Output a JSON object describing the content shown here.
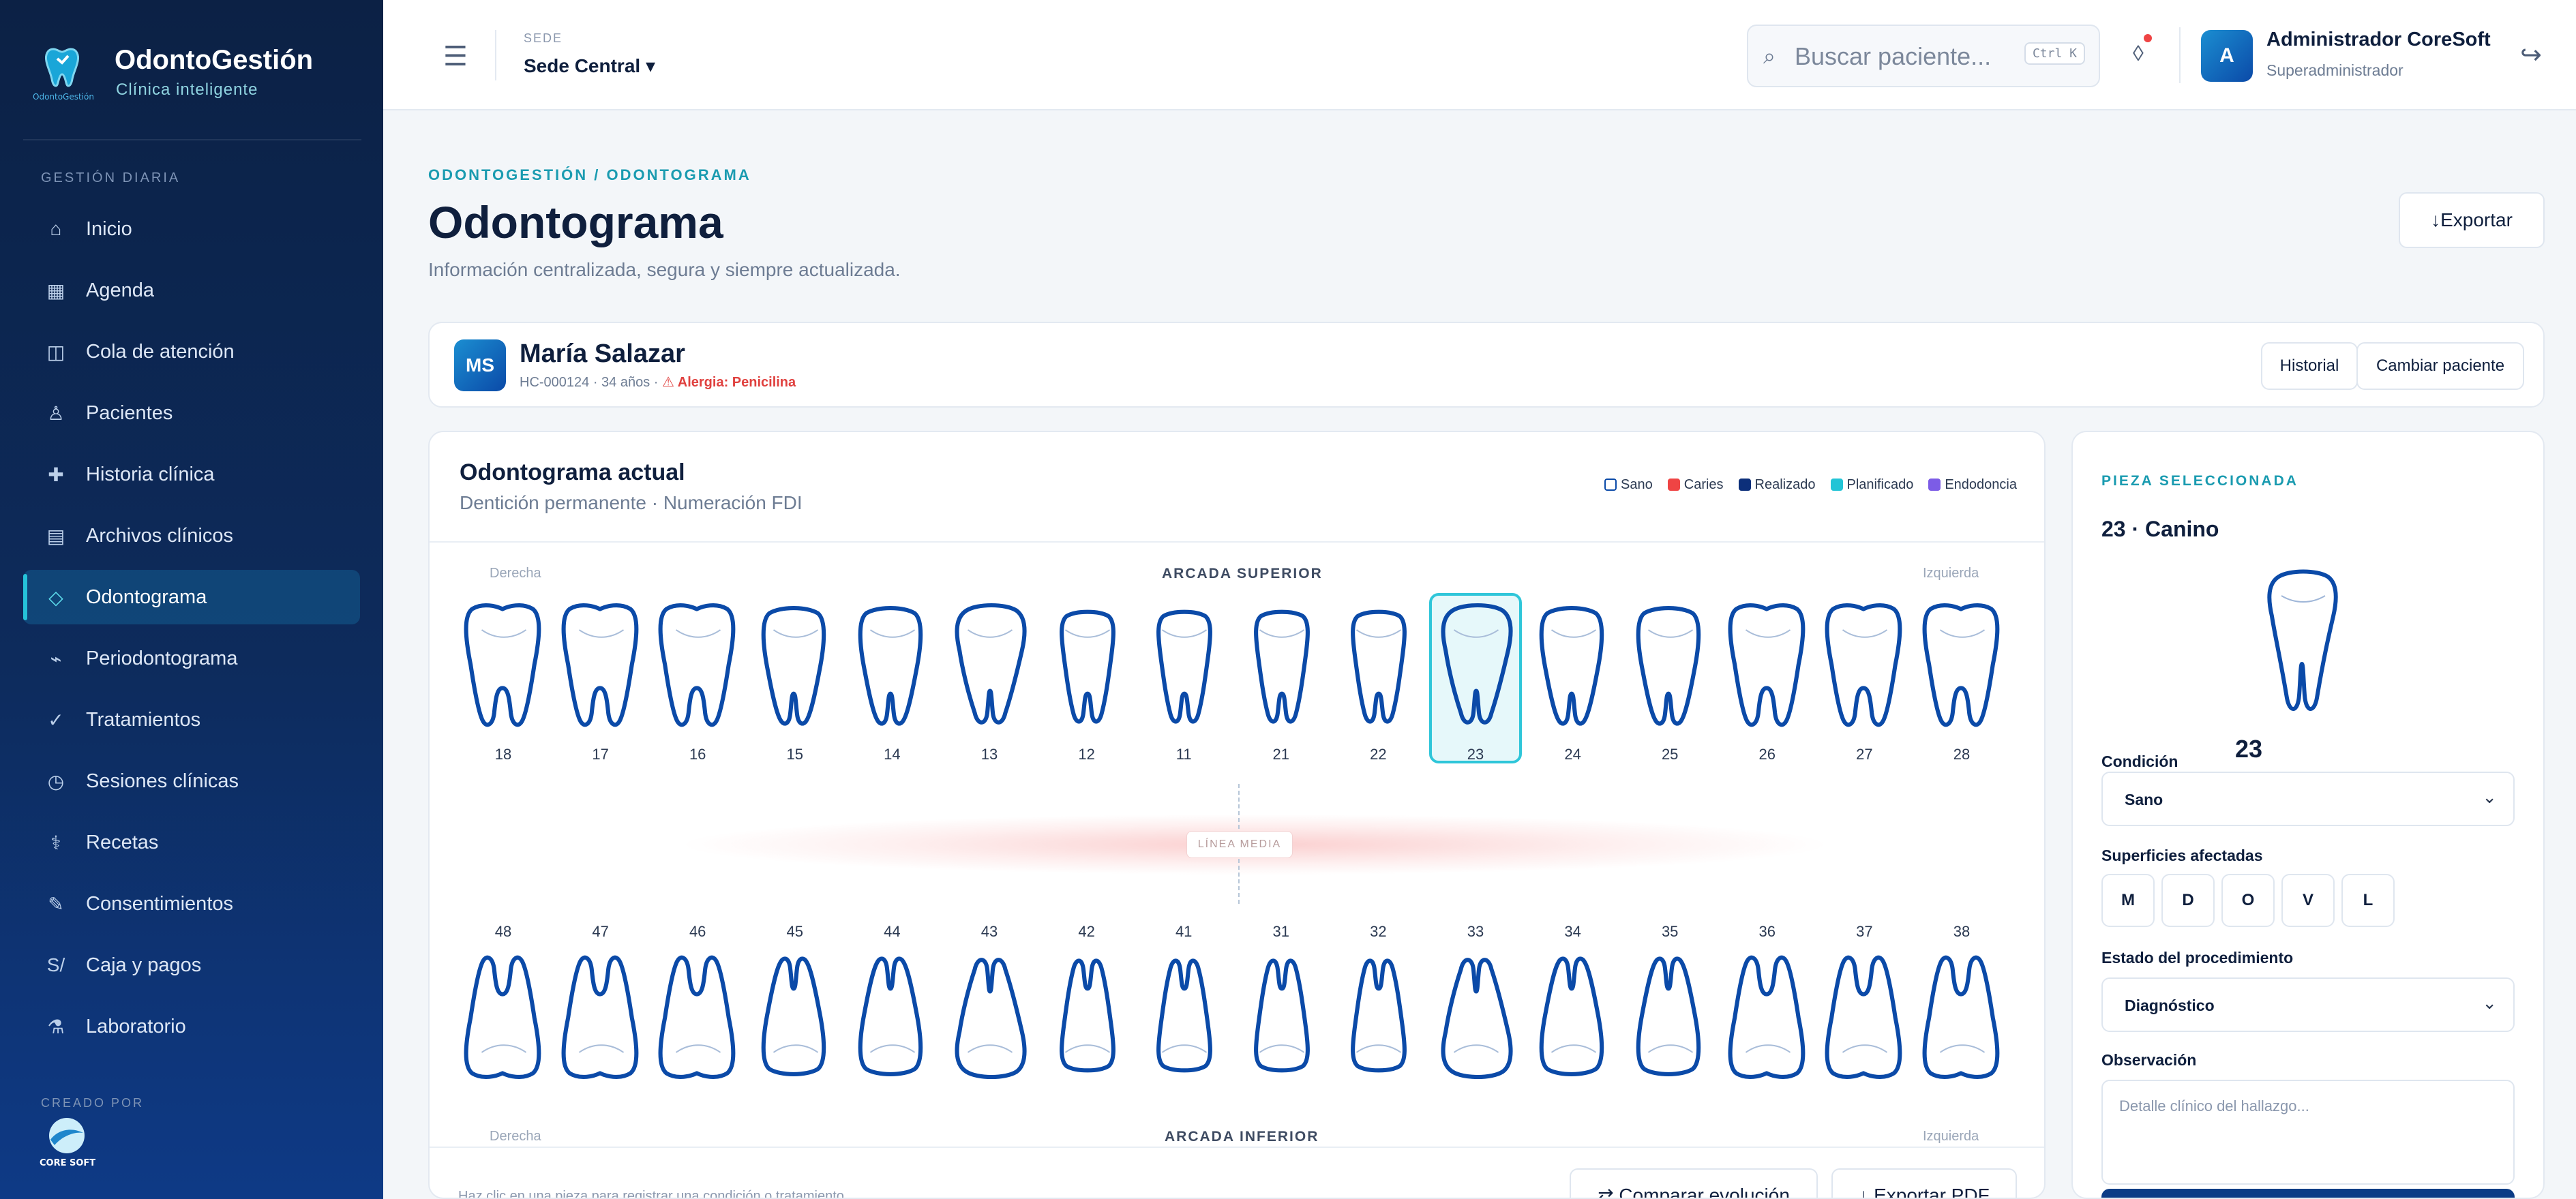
{
  "brand": {
    "title": "OdontoGestión",
    "subtitle": "Clínica inteligente",
    "logo_text": "OdontoGestión"
  },
  "sidebar": {
    "section_label": "GESTIÓN DIARIA",
    "items": [
      {
        "label": "Inicio",
        "icon": "home-icon",
        "glyph": "⌂"
      },
      {
        "label": "Agenda",
        "icon": "calendar-icon",
        "glyph": "▦"
      },
      {
        "label": "Cola de atención",
        "icon": "queue-icon",
        "glyph": "◫"
      },
      {
        "label": "Pacientes",
        "icon": "user-icon",
        "glyph": "♙"
      },
      {
        "label": "Historia clínica",
        "icon": "plus-icon",
        "glyph": "✚"
      },
      {
        "label": "Archivos clínicos",
        "icon": "files-icon",
        "glyph": "▤"
      },
      {
        "label": "Odontograma",
        "icon": "diamond-icon",
        "glyph": "◇",
        "active": true
      },
      {
        "label": "Periodontograma",
        "icon": "pulse-icon",
        "glyph": "⌁"
      },
      {
        "label": "Tratamientos",
        "icon": "check-icon",
        "glyph": "✓"
      },
      {
        "label": "Sesiones clínicas",
        "icon": "clock-icon",
        "glyph": "◷"
      },
      {
        "label": "Recetas",
        "icon": "pill-icon",
        "glyph": "⚕"
      },
      {
        "label": "Consentimientos",
        "icon": "pen-icon",
        "glyph": "✎"
      },
      {
        "label": "Caja y pagos",
        "icon": "currency-icon",
        "glyph": "S/"
      },
      {
        "label": "Laboratorio",
        "icon": "flask-icon",
        "glyph": "⚗"
      }
    ],
    "created_by": "CREADO POR",
    "coresoft_label": "CORE SOFT"
  },
  "topbar": {
    "menu_glyph": "☰",
    "sede_label": "SEDE",
    "sede_value": "Sede Central ▾",
    "search_placeholder": "Buscar paciente...",
    "search_glyph": "⌕",
    "search_shortcut": "Ctrl K",
    "notif_glyph": "◊",
    "user_initial": "A",
    "user_name": "Administrador CoreSoft",
    "user_role": "Superadministrador",
    "logout_glyph": "↪"
  },
  "page": {
    "breadcrumb": "ODONTOGESTIÓN / ODONTOGRAMA",
    "title": "Odontograma",
    "subtitle": "Información centralizada, segura y siempre actualizada.",
    "export_label": "↓Exportar"
  },
  "patient": {
    "initials": "MS",
    "name": "María Salazar",
    "meta": "HC-000124 · 34 años · ",
    "allergy": "⚠ Alergia: Penicilina",
    "history_label": "Historial",
    "change_label": "Cambiar paciente"
  },
  "odontogram": {
    "title": "Odontograma actual",
    "subtitle": "Dentición permanente · Numeración FDI",
    "legend": [
      {
        "label": "Sano",
        "color": "#ffffff",
        "border": "#0b4aa8"
      },
      {
        "label": "Caries",
        "color": "#ef4444",
        "border": "#ef4444"
      },
      {
        "label": "Realizado",
        "color": "#0c2f7a",
        "border": "#0c2f7a"
      },
      {
        "label": "Planificado",
        "color": "#22c4d6",
        "border": "#22c4d6"
      },
      {
        "label": "Endodoncia",
        "color": "#7c5ce6",
        "border": "#7c5ce6"
      }
    ],
    "upper_label": "ARCADA SUPERIOR",
    "lower_label": "ARCADA INFERIOR",
    "right_label": "Derecha",
    "left_label": "Izquierda",
    "midline_label": "LÍNEA MEDIA",
    "upper_teeth": [
      "18",
      "17",
      "16",
      "15",
      "14",
      "13",
      "12",
      "11",
      "21",
      "22",
      "23",
      "24",
      "25",
      "26",
      "27",
      "28"
    ],
    "lower_teeth": [
      "48",
      "47",
      "46",
      "45",
      "44",
      "43",
      "42",
      "41",
      "31",
      "32",
      "33",
      "34",
      "35",
      "36",
      "37",
      "38"
    ],
    "selected_tooth": "23",
    "hint": "Haz clic en una pieza para registrar una condición o tratamiento.",
    "compare_label": "⇄ Comparar evolución",
    "pdf_label": "↓ Exportar PDF"
  },
  "selected": {
    "section_label": "PIEZA SELECCIONADA",
    "title": "23 · Canino",
    "number": "23",
    "condition_label": "Condición",
    "condition_value": "Sano",
    "surfaces_label": "Superficies afectadas",
    "surfaces": [
      "M",
      "D",
      "O",
      "V",
      "L"
    ],
    "procedure_label": "Estado del procedimiento",
    "procedure_value": "Diagnóstico",
    "observation_label": "Observación",
    "observation_placeholder": "Detalle clínico del hallazgo...",
    "chevron_glyph": "⌄"
  },
  "colors": {
    "accent": "#1a9bb0",
    "tooth_stroke": "#0b4aa8",
    "sidebar_top": "#0c2145"
  }
}
